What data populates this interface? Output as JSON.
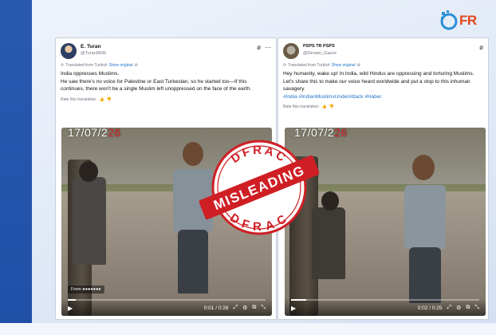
{
  "brand": {
    "logo_text": "FR",
    "accent": "#e2481c",
    "seal_color": "#cf1f25"
  },
  "seal": {
    "top_text": "DFRAC",
    "bottom_text": "DFRAC",
    "banner": "MISLEADING"
  },
  "left_post": {
    "name": "E. Turan",
    "handle": "@Turan9636",
    "translated_label": "Translated from Turkish",
    "show_original": "Show original",
    "text_line1": "India oppresses Muslims.",
    "text_body": "He saw there's no voice for Palestine or East Turkestan, so he started too—If this continues, there won't be a single Muslim left unoppressed on the face of the earth.",
    "rate_label": "Rate this translation:",
    "video": {
      "date_stamp_a": "17/07/2",
      "date_stamp_b": "26",
      "from_label": "From ",
      "time": "0:01 / 0:26",
      "progress": 0.04
    }
  },
  "right_post": {
    "name": "PSPS TR PSPS",
    "handle": "@Devam_Gazze",
    "translated_label": "Translated from Turkish",
    "show_original": "Show original",
    "text_body": "Hey humanity, wake up! In India, wild Hindus are oppressing and torturing Muslims. Let's share this to make our voice heard worldwide and put a stop to this inhuman savagery.",
    "hashtags": "#India #IndianMuslimsUnderAttack #Haber",
    "rate_label": "Rate this translation:",
    "video": {
      "date_stamp_a": "17/07/2",
      "date_stamp_b": "26",
      "time": "0:02 / 0:25",
      "progress": 0.08
    }
  }
}
